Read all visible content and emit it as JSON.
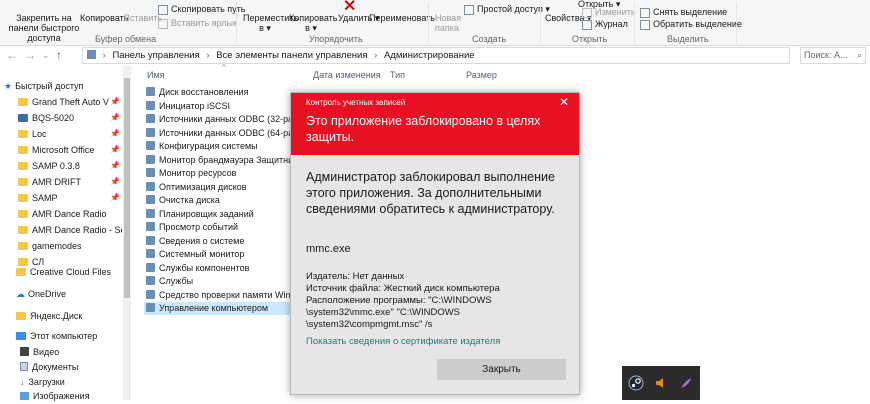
{
  "ribbon": {
    "pin_quick": "Закрепить на панели быстрого доступа",
    "copy": "Копировать",
    "paste": "Вставить",
    "copy_path": "Скопировать путь",
    "paste_shortcut": "Вставить ярлык",
    "move_to": "Переместить в ▾",
    "copy_to": "Копировать в ▾",
    "delete": "Удалить ▾",
    "rename": "Переименовать",
    "new_folder": "Новая папка",
    "easy_access": "Простой доступ ▾",
    "properties": "Свойства ▾",
    "open": "Открыть ▾",
    "edit": "Изменить",
    "history": "Журнал",
    "select_none": "Снять выделение",
    "invert_selection": "Обратить выделение",
    "groups": {
      "clipboard": "Буфер обмена",
      "organize": "Упорядочить",
      "new": "Создать",
      "open": "Открыть",
      "select": "Выделить"
    }
  },
  "address": {
    "crumbs": [
      "Панель управления",
      "Все элементы панели управления",
      "Администрирование"
    ],
    "search_placeholder": "Поиск: А..."
  },
  "sidebar": {
    "quick_access": "Быстрый доступ",
    "pinned": [
      "Grand Theft Auto V",
      "BQS-5020",
      "Loc",
      "Microsoft Office",
      "SAMP 0.3.8",
      "AMR DRIFT",
      "SAMP"
    ],
    "folders": [
      "AMR Dance Radio",
      "AMR Dance Radio - Ser-S_",
      "gamemodes",
      "СЛ"
    ],
    "creative_cloud": "Creative Cloud Files",
    "onedrive": "OneDrive",
    "yandex": "Яндекс.Диск",
    "this_pc": "Этот компьютер",
    "pc_items": [
      "Видео",
      "Документы",
      "Загрузки",
      "Изображения"
    ]
  },
  "list": {
    "columns": [
      "Имя",
      "Дата изменения",
      "Тип",
      "Размер"
    ],
    "files": [
      "Диск восстановления",
      "Инициатор iSCSI",
      "Источники данных ODBC (32-разрядная)",
      "Источники данных ODBC (64-разрядная)",
      "Конфигурация системы",
      "Монитор брандмауэра Защитника Windows",
      "Монитор ресурсов",
      "Оптимизация дисков",
      "Очистка диска",
      "Планировщик заданий",
      "Просмотр событий",
      "Сведения о системе",
      "Системный монитор",
      "Службы компонентов",
      "Службы",
      "Средство проверки памяти Windows",
      "Управление компьютером"
    ]
  },
  "uac": {
    "caption": "Контроль учетных записей",
    "title": "Это приложение заблокировано в целях защиты.",
    "message": "Администратор заблокировал выполнение этого приложения. За дополнительными сведениями обратитесь к администратору.",
    "program": "mmc.exe",
    "publisher": "Издатель: Нет данных",
    "origin": "Источник файла: Жесткий диск компьютера",
    "location_line1": "Расположение программы: \"C:\\WINDOWS",
    "location_line2": "\\system32\\mmc.exe\" \"C:\\WINDOWS",
    "location_line3": "\\system32\\compmgmt.msc\" /s",
    "cert_link": "Показать сведения о сертификате издателя",
    "close_button": "Закрыть",
    "color": "#e81123"
  }
}
